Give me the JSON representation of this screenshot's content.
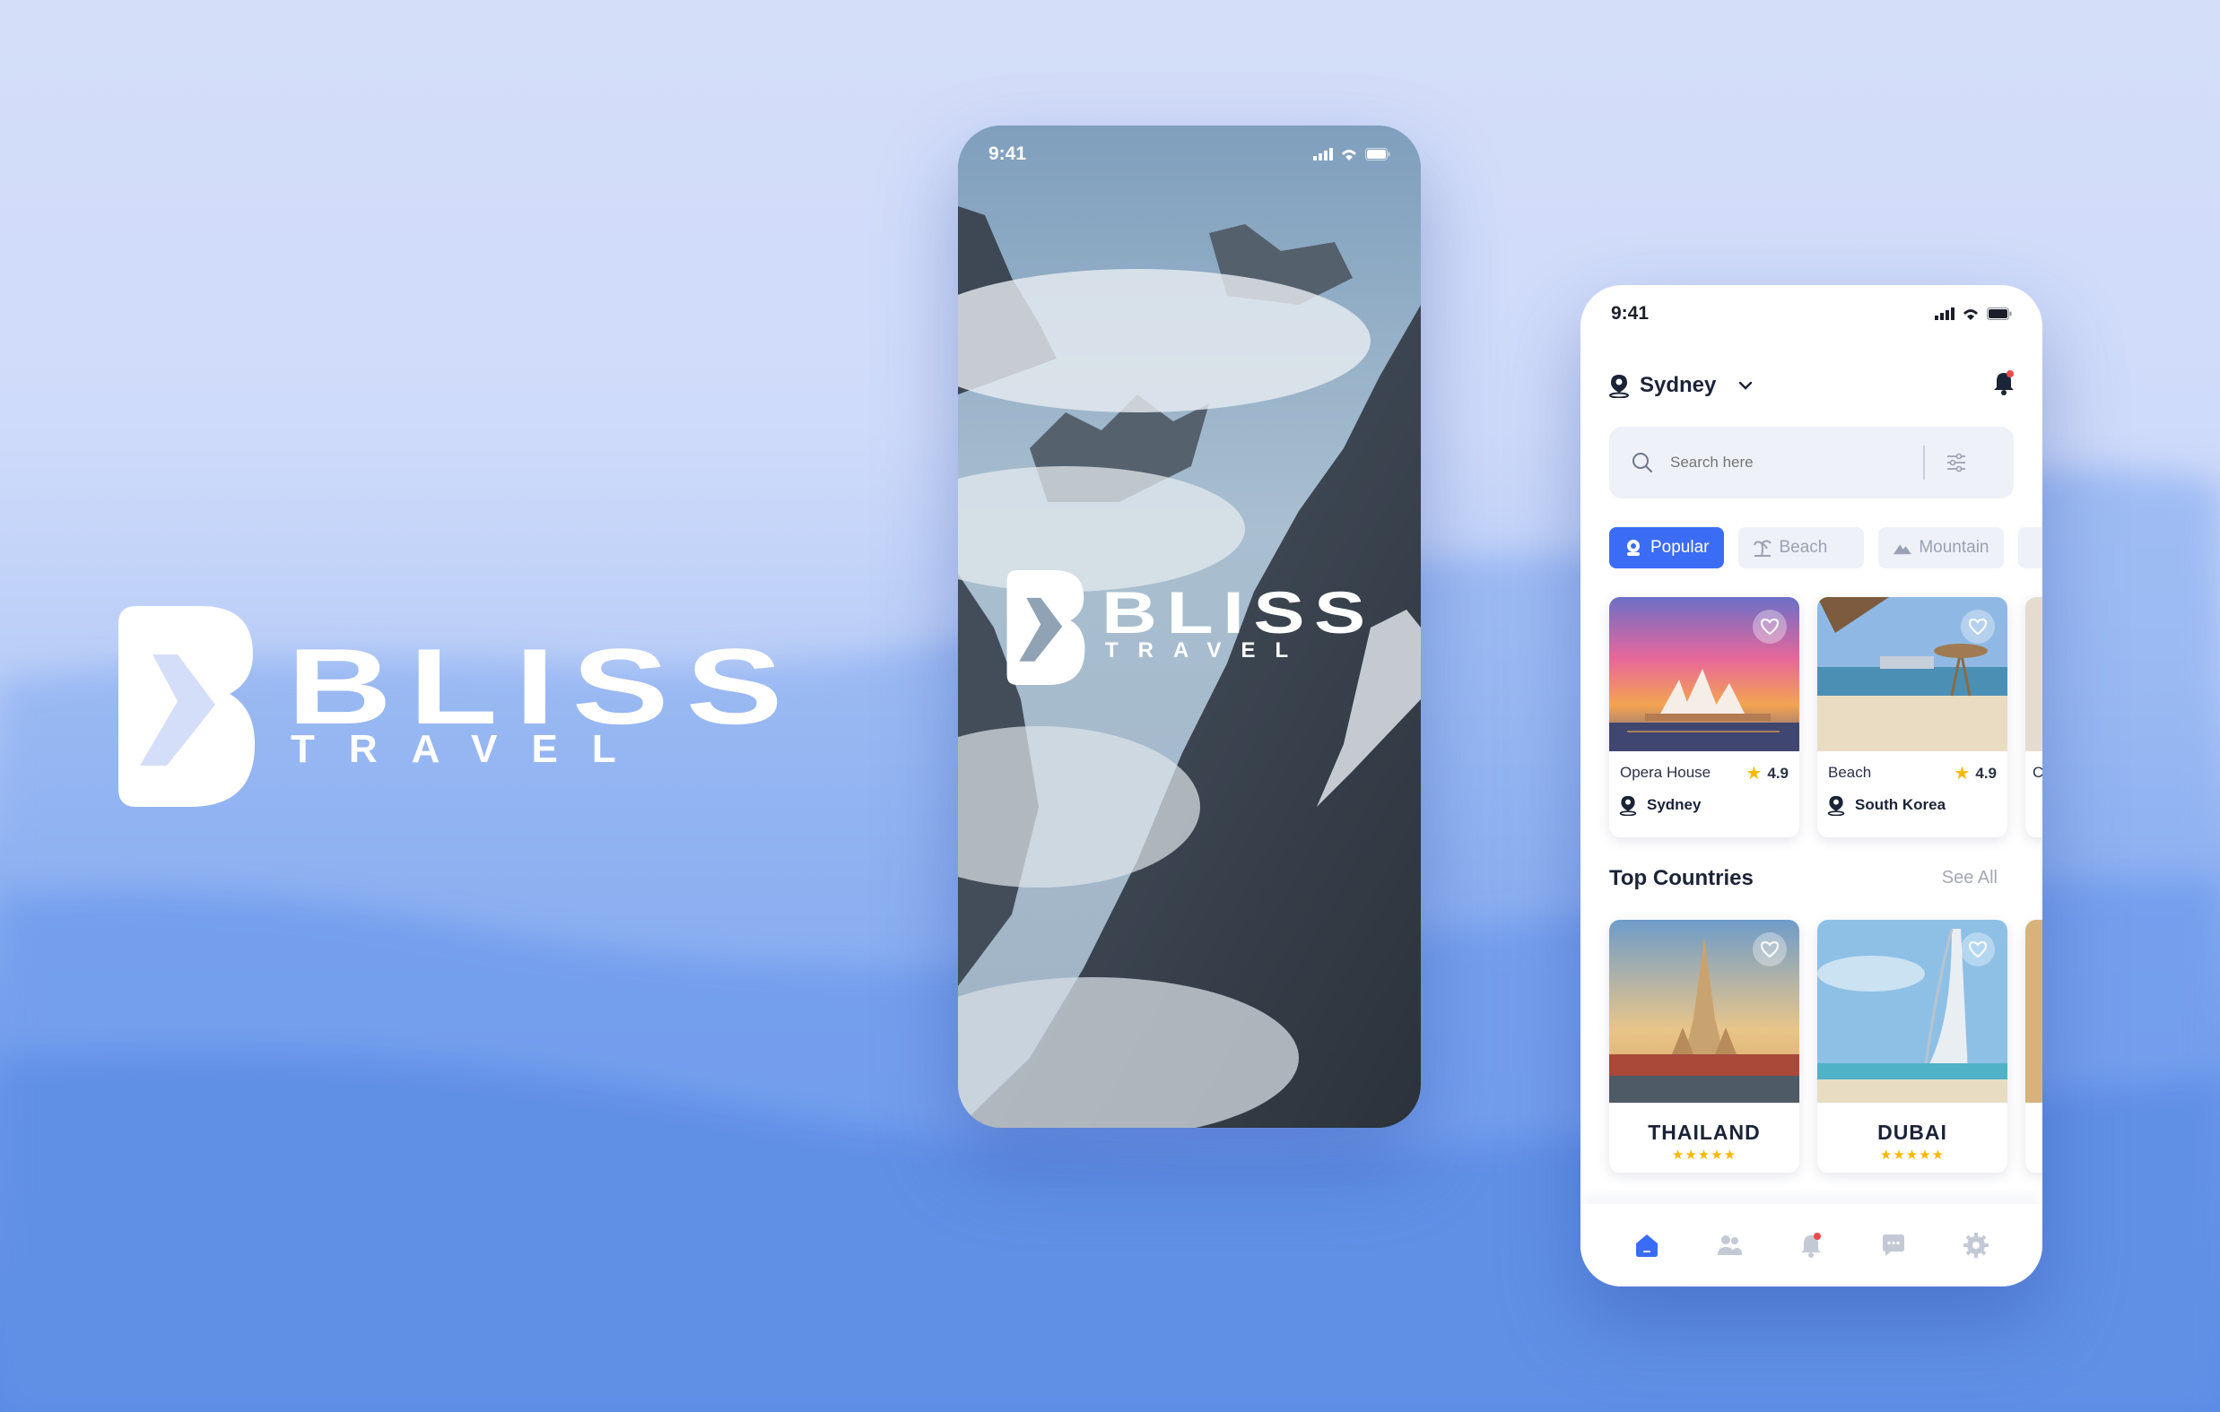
{
  "brand": {
    "word": "BLISS",
    "tagline": "TRAVEL"
  },
  "splash": {
    "time": "9:41"
  },
  "home": {
    "time": "9:41",
    "location": "Sydney",
    "search_placeholder": "Search here",
    "categories": [
      {
        "label": "Popular",
        "active": true
      },
      {
        "label": "Beach",
        "active": false
      },
      {
        "label": "Mountain",
        "active": false
      }
    ],
    "places": [
      {
        "name": "Opera House",
        "rating": "4.9",
        "city": "Sydney"
      },
      {
        "name": "Beach",
        "rating": "4.9",
        "city": "South Korea"
      }
    ],
    "partial_next_place_initial": "C",
    "section_title": "Top Countries",
    "see_all": "See All",
    "countries": [
      {
        "name": "THAILAND",
        "stars": "★★★★★"
      },
      {
        "name": "DUBAI",
        "stars": "★★★★★"
      }
    ],
    "tabs": [
      "home-icon",
      "users-icon",
      "bell-icon",
      "chat-icon",
      "settings-icon"
    ]
  },
  "colors": {
    "accent": "#3b6cf5",
    "star": "#f5b800",
    "dark_text": "#1b2337",
    "notify": "#f04848"
  }
}
